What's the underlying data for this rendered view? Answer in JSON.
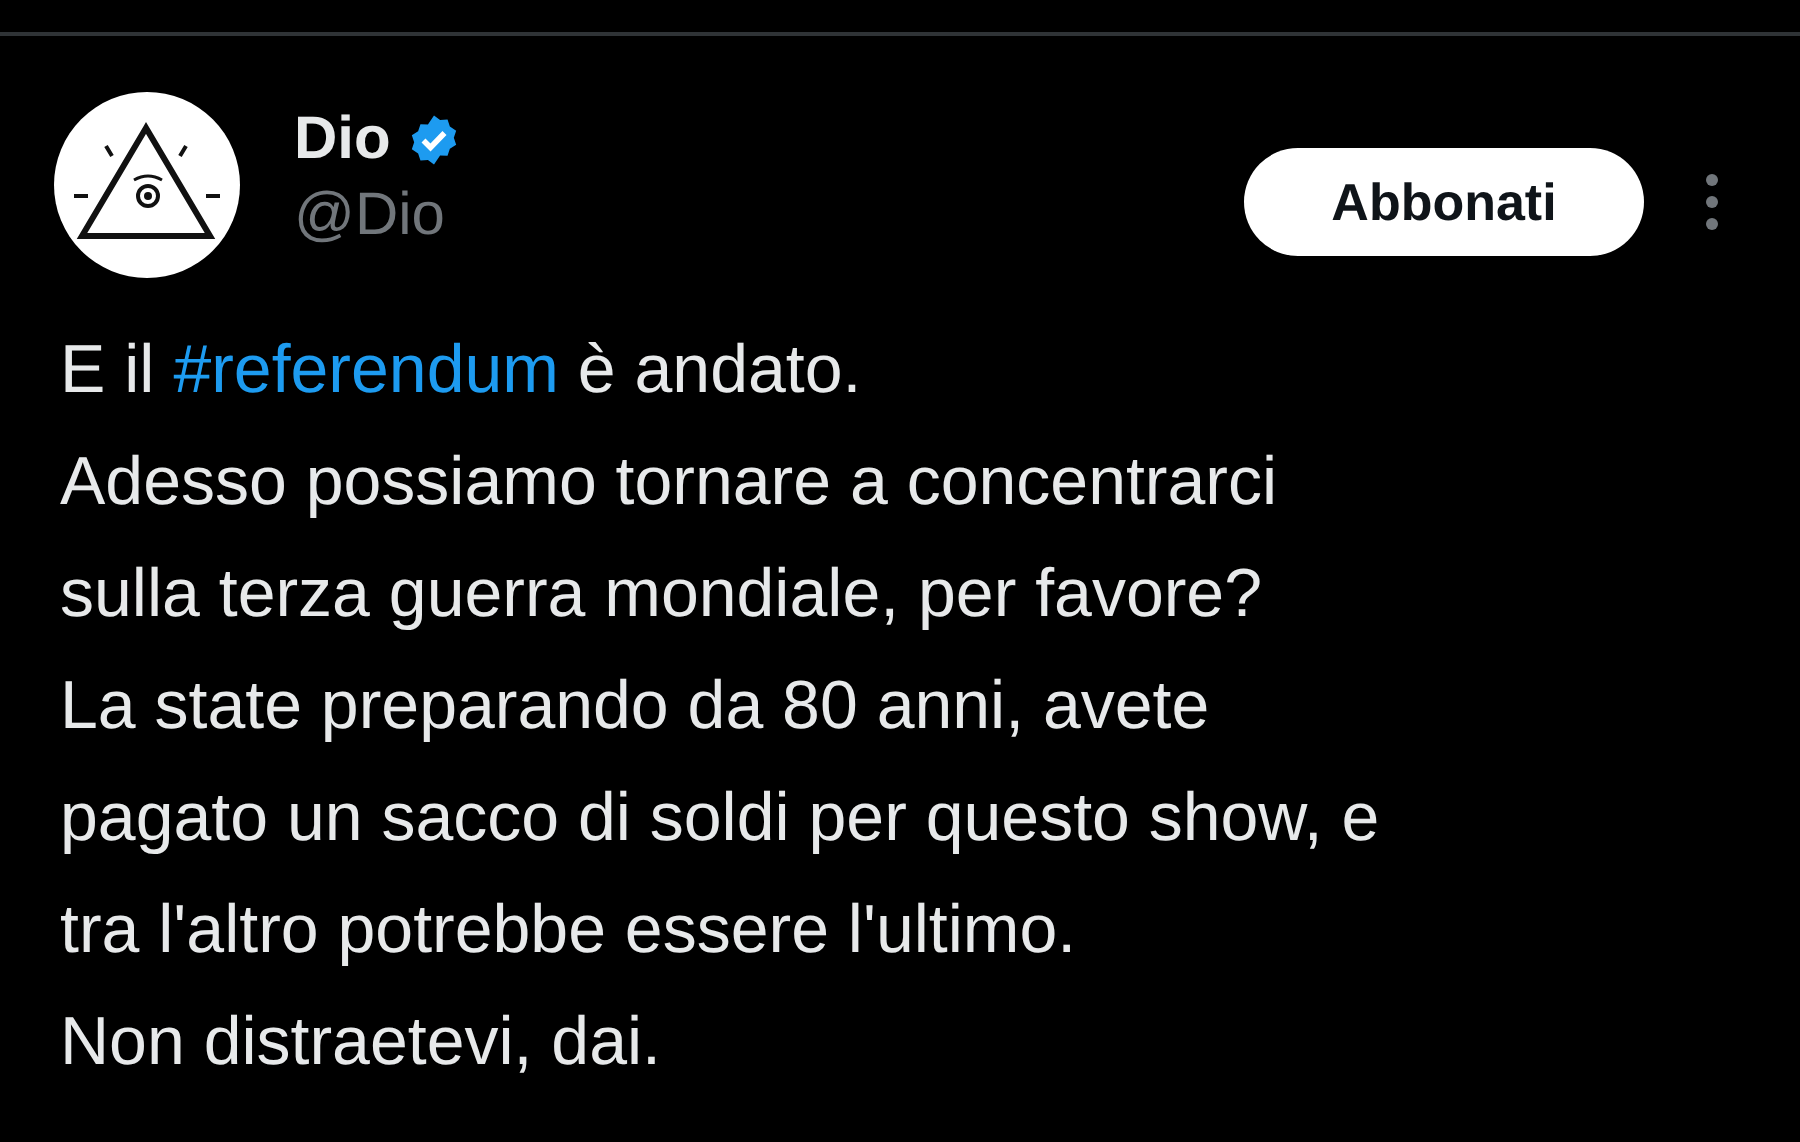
{
  "author": {
    "name": "Dio",
    "verified": true,
    "handle": "@Dio"
  },
  "follow_button": {
    "label": "Abbonati"
  },
  "tweet": {
    "lines": [
      [
        {
          "kind": "text",
          "text": "E il "
        },
        {
          "kind": "hashtag",
          "text": "#referendum"
        },
        {
          "kind": "text",
          "text": " è andato."
        }
      ],
      [
        {
          "kind": "text",
          "text": "Adesso possiamo tornare a concentrarci"
        }
      ],
      [
        {
          "kind": "text",
          "text": "sulla terza guerra mondiale, per favore?"
        }
      ],
      [
        {
          "kind": "text",
          "text": "La state preparando da 80 anni, avete"
        }
      ],
      [
        {
          "kind": "text",
          "text": "pagato un sacco di soldi per questo show, e"
        }
      ],
      [
        {
          "kind": "text",
          "text": "tra l'altro potrebbe essere l'ultimo."
        }
      ],
      [
        {
          "kind": "text",
          "text": "Non distraetevi, dai."
        }
      ]
    ]
  }
}
